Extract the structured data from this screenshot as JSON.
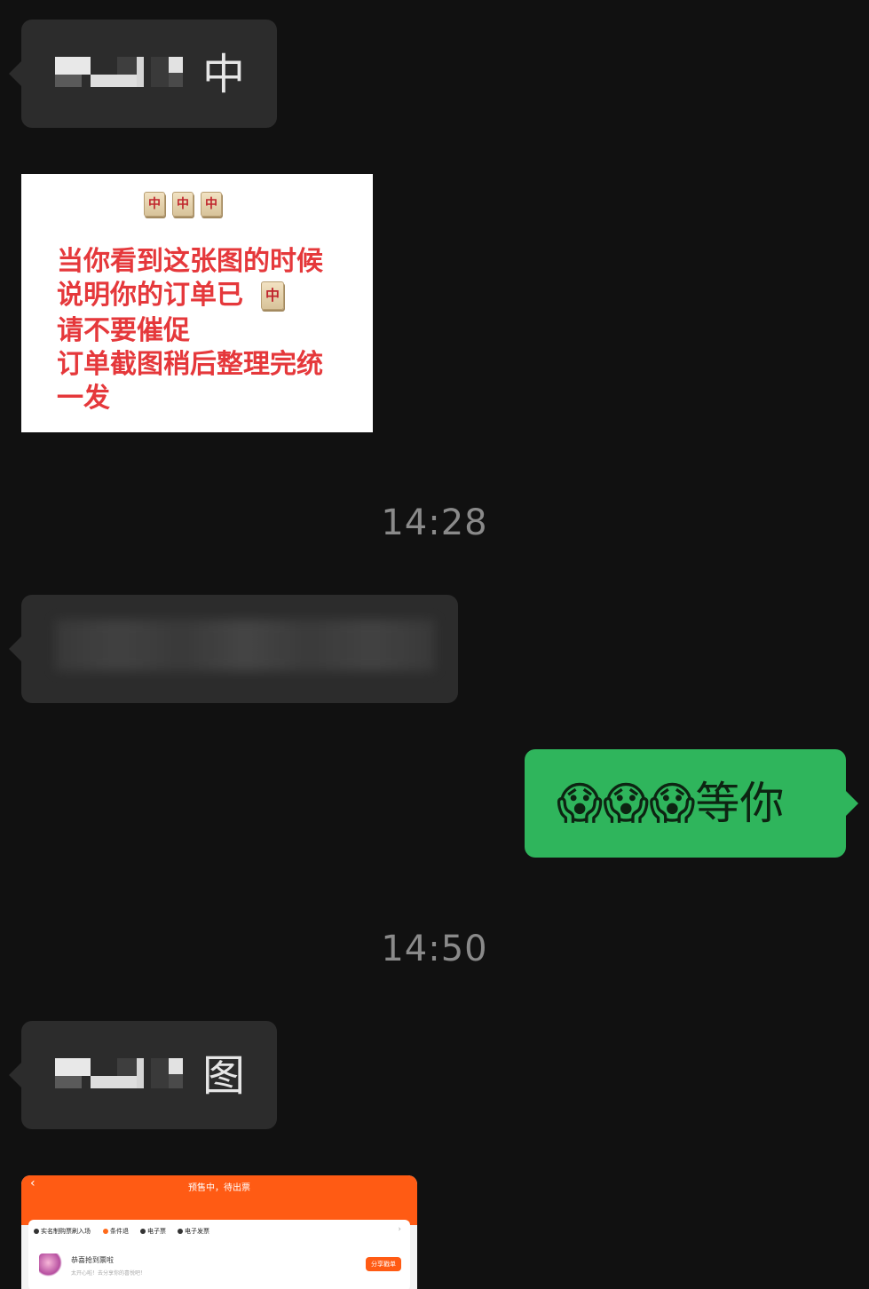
{
  "messages": {
    "first": {
      "text_suffix": "中"
    },
    "poster": {
      "tiles": [
        "中",
        "中",
        "中"
      ],
      "lines": [
        "当你看到这张图的时候",
        "说明你的订单已",
        "请不要催促",
        "订单截图稍后整理完统",
        "一发"
      ],
      "inline_tile": "中"
    },
    "time_1": "14:28",
    "outgoing": {
      "text": "😱😱😱等你"
    },
    "time_2": "14:50",
    "third": {
      "text_suffix": "图"
    },
    "order_screenshot": {
      "title": "预售中，待出票",
      "back": "‹",
      "tags": [
        "实名制购票刷入场",
        "条件退",
        "电子票",
        "电子发票"
      ],
      "chevron": "›",
      "message": "恭喜抢到票啦",
      "sub": "太开心啦！去分享你的喜悦吧！",
      "share": "分享戳单"
    }
  },
  "colors": {
    "background": "#111111",
    "incoming_bubble": "#2c2c2c",
    "outgoing_bubble": "#2fb55c",
    "poster_text": "#e5383b",
    "order_header": "#ff5b14"
  }
}
